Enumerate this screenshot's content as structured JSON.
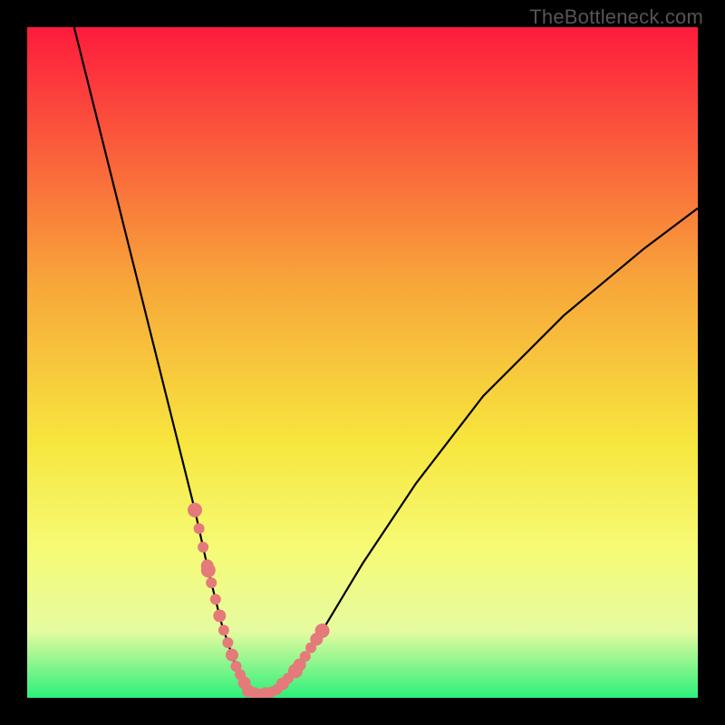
{
  "watermark": "TheBottleneck.com",
  "colors": {
    "black": "#000000",
    "curve": "#000000",
    "marker": "#e47a7a",
    "grad_top": "#fd1b3c",
    "grad_mid1": "#f7a63a",
    "grad_mid2": "#f7e63e",
    "grad_mid3": "#f6fb76",
    "grad_mid4": "#e6fba0",
    "grad_bot": "#2cf07a"
  },
  "chart_data": {
    "type": "line",
    "title": "",
    "xlabel": "",
    "ylabel": "",
    "xlim": [
      0,
      100
    ],
    "ylim": [
      0,
      100
    ],
    "min_x": 33,
    "series": [
      {
        "name": "bottleneck-curve",
        "x": [
          7,
          10,
          13,
          16,
          19,
          22,
          25,
          27,
          29,
          31,
          33,
          35,
          37,
          40,
          44,
          50,
          58,
          68,
          80,
          92,
          100
        ],
        "values": [
          100,
          88,
          76,
          64,
          52,
          40,
          28,
          19,
          11,
          5,
          1,
          0.5,
          1,
          4,
          10,
          20,
          32,
          45,
          57,
          67,
          73
        ]
      }
    ],
    "markers": {
      "comment": "salmon dotted segments overlaid on lower part of curve",
      "left_branch": {
        "x_start": 25,
        "x_end": 33,
        "y_start": 28,
        "y_end": 1
      },
      "right_branch": {
        "x_start": 33,
        "x_end": 44,
        "y_start": 1,
        "y_end": 10
      },
      "style": "dotted",
      "radius": 6
    },
    "background": {
      "type": "vertical-gradient",
      "stops": [
        {
          "pos": 0.0,
          "color": "#fd1b3c"
        },
        {
          "pos": 0.38,
          "color": "#f7a63a"
        },
        {
          "pos": 0.62,
          "color": "#f7e63e"
        },
        {
          "pos": 0.78,
          "color": "#f6fb76"
        },
        {
          "pos": 0.9,
          "color": "#e6fba0"
        },
        {
          "pos": 1.0,
          "color": "#2cf07a"
        }
      ]
    }
  }
}
